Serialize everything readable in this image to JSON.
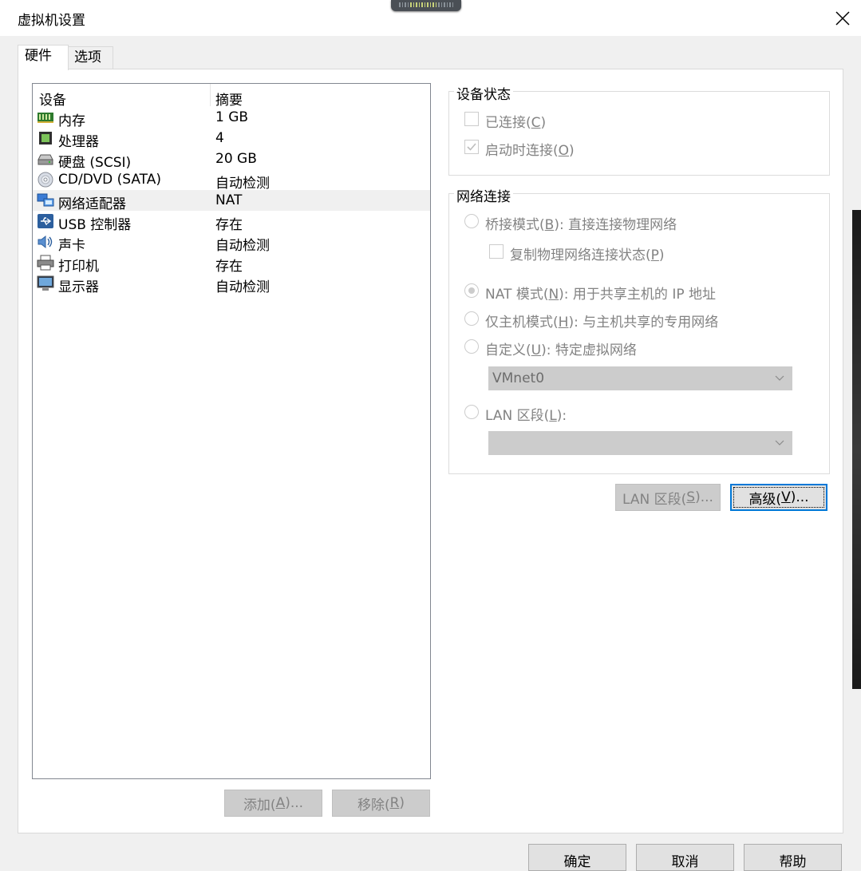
{
  "window": {
    "title": "虚拟机设置"
  },
  "tabs": [
    {
      "label": "硬件"
    },
    {
      "label": "选项"
    }
  ],
  "device_list": {
    "headers": {
      "device": "设备",
      "summary": "摘要"
    },
    "rows": [
      {
        "icon": "memory-icon",
        "name": "内存",
        "summary": "1 GB"
      },
      {
        "icon": "processor-icon",
        "name": "处理器",
        "summary": "4"
      },
      {
        "icon": "hard-disk-icon",
        "name": "硬盘 (SCSI)",
        "summary": "20 GB"
      },
      {
        "icon": "cd-dvd-icon",
        "name": "CD/DVD (SATA)",
        "summary": "自动检测"
      },
      {
        "icon": "network-adapter-icon",
        "name": "网络适配器",
        "summary": "NAT"
      },
      {
        "icon": "usb-icon",
        "name": "USB 控制器",
        "summary": "存在"
      },
      {
        "icon": "sound-card-icon",
        "name": "声卡",
        "summary": "自动检测"
      },
      {
        "icon": "printer-icon",
        "name": "打印机",
        "summary": "存在"
      },
      {
        "icon": "display-icon",
        "name": "显示器",
        "summary": "自动检测"
      }
    ],
    "selected": "网络适配器"
  },
  "left_buttons": {
    "add": {
      "pre": "添加(",
      "key": "A",
      "post": ")..."
    },
    "remove": {
      "pre": "移除(",
      "key": "R",
      "post": ")"
    }
  },
  "device_status": {
    "title": "设备状态",
    "connected": {
      "pre": "已连接(",
      "key": "C",
      "post": ")",
      "checked": false
    },
    "connect_at_power_on": {
      "pre": "启动时连接(",
      "key": "O",
      "post": ")",
      "checked": true
    }
  },
  "network": {
    "title": "网络连接",
    "bridged": {
      "pre": "桥接模式(",
      "key": "B",
      "post": "): 直接连接物理网络"
    },
    "replicate": {
      "pre": "复制物理网络连接状态(",
      "key": "P",
      "post": ")"
    },
    "nat": {
      "pre": "NAT 模式(",
      "key": "N",
      "post": "): 用于共享主机的 IP 地址",
      "checked": true
    },
    "host_only": {
      "pre": "仅主机模式(",
      "key": "H",
      "post": "): 与主机共享的专用网络"
    },
    "custom": {
      "pre": "自定义(",
      "key": "U",
      "post": "): 特定虚拟网络"
    },
    "custom_select": "VMnet0",
    "lan_segment": {
      "pre": "LAN 区段(",
      "key": "L",
      "post": "):"
    },
    "lan_select": ""
  },
  "right_buttons": {
    "lan_segments": {
      "pre": "LAN 区段(",
      "key": "S",
      "post": ")..."
    },
    "advanced": {
      "pre": "高级(",
      "key": "V",
      "post": ")..."
    }
  },
  "dialog_buttons": {
    "ok": "确定",
    "cancel": "取消",
    "help": "帮助"
  }
}
